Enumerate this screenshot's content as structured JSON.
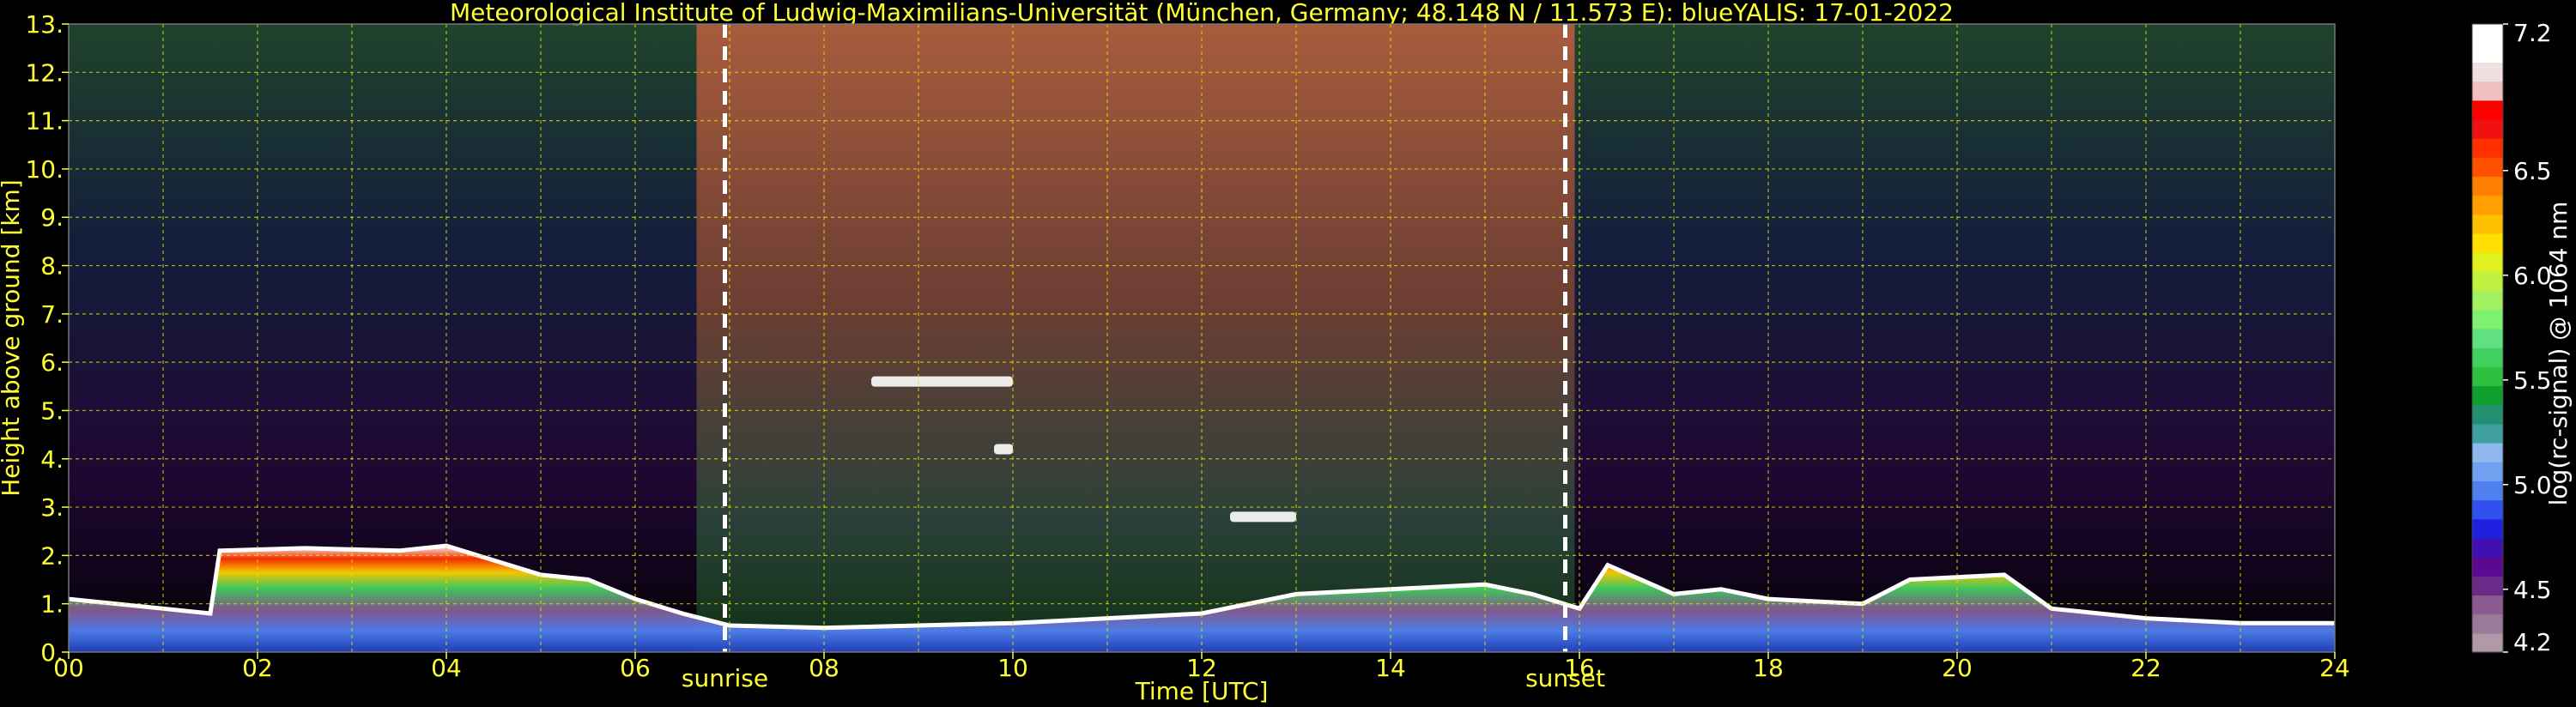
{
  "colors": {
    "background": "#000000",
    "text": "#ffff33",
    "grid": "#e6e600",
    "marker_line": "#ffffff",
    "colorbar_text": "#ffffff"
  },
  "chart_data": {
    "type": "heatmap",
    "title": "Meteorological Institute of Ludwig-Maximilians-Universität (München, Germany; 48.148 N / 11.573 E):    blueYALIS: 17-01-2022",
    "xlabel": "Time [UTC]",
    "ylabel": "Height above ground [km]",
    "xlim": [
      0,
      24
    ],
    "ylim": [
      0,
      13
    ],
    "x_ticks": [
      {
        "value": 0,
        "label": "00"
      },
      {
        "value": 2,
        "label": "02"
      },
      {
        "value": 4,
        "label": "04"
      },
      {
        "value": 6,
        "label": "06"
      },
      {
        "value": 8,
        "label": "08"
      },
      {
        "value": 10,
        "label": "10"
      },
      {
        "value": 12,
        "label": "12"
      },
      {
        "value": 14,
        "label": "14"
      },
      {
        "value": 16,
        "label": "16"
      },
      {
        "value": 18,
        "label": "18"
      },
      {
        "value": 20,
        "label": "20"
      },
      {
        "value": 22,
        "label": "22"
      },
      {
        "value": 24,
        "label": "24"
      }
    ],
    "y_ticks": [
      {
        "value": 0,
        "label": "0."
      },
      {
        "value": 1,
        "label": "1."
      },
      {
        "value": 2,
        "label": "2."
      },
      {
        "value": 3,
        "label": "3."
      },
      {
        "value": 4,
        "label": "4."
      },
      {
        "value": 5,
        "label": "5."
      },
      {
        "value": 6,
        "label": "6."
      },
      {
        "value": 7,
        "label": "7."
      },
      {
        "value": 8,
        "label": "8."
      },
      {
        "value": 9,
        "label": "9."
      },
      {
        "value": 10,
        "label": "10."
      },
      {
        "value": 11,
        "label": "11."
      },
      {
        "value": 12,
        "label": "12."
      },
      {
        "value": 13,
        "label": "13."
      }
    ],
    "grid": true,
    "markers": [
      {
        "label": "sunrise",
        "x": 6.95
      },
      {
        "label": "sunset",
        "x": 15.85
      }
    ],
    "boundary_layer_top_km": [
      [
        0.0,
        1.1
      ],
      [
        0.5,
        1.0
      ],
      [
        1.0,
        0.9
      ],
      [
        1.5,
        0.8
      ],
      [
        1.6,
        2.1
      ],
      [
        2.5,
        2.15
      ],
      [
        3.5,
        2.1
      ],
      [
        4.0,
        2.2
      ],
      [
        4.5,
        1.9
      ],
      [
        5.0,
        1.6
      ],
      [
        5.5,
        1.5
      ],
      [
        6.0,
        1.1
      ],
      [
        6.5,
        0.8
      ],
      [
        7.0,
        0.55
      ],
      [
        8.0,
        0.5
      ],
      [
        9.0,
        0.55
      ],
      [
        10.0,
        0.6
      ],
      [
        11.0,
        0.7
      ],
      [
        12.0,
        0.8
      ],
      [
        13.0,
        1.2
      ],
      [
        14.0,
        1.3
      ],
      [
        15.0,
        1.4
      ],
      [
        15.5,
        1.2
      ],
      [
        16.0,
        0.9
      ],
      [
        16.3,
        1.8
      ],
      [
        17.0,
        1.2
      ],
      [
        17.5,
        1.3
      ],
      [
        18.0,
        1.1
      ],
      [
        19.0,
        1.0
      ],
      [
        19.5,
        1.5
      ],
      [
        20.5,
        1.6
      ],
      [
        21.0,
        0.9
      ],
      [
        22.0,
        0.7
      ],
      [
        23.0,
        0.6
      ],
      [
        24.0,
        0.6
      ]
    ],
    "clouds": [
      {
        "time_start": 8.5,
        "time_end": 10.0,
        "height_km": 5.6
      },
      {
        "time_start": 9.8,
        "time_end": 10.0,
        "height_km": 4.2
      },
      {
        "time_start": 12.3,
        "time_end": 13.0,
        "height_km": 2.8
      }
    ],
    "colorbar": {
      "label": "log(rc-signal) @ 1064 nm",
      "min": 4.2,
      "max": 7.2,
      "ticks": [
        {
          "value": 4.2,
          "label": "4.2"
        },
        {
          "value": 4.5,
          "label": "4.5"
        },
        {
          "value": 5.0,
          "label": "5.0"
        },
        {
          "value": 5.5,
          "label": "5.5"
        },
        {
          "value": 6.0,
          "label": "6.0"
        },
        {
          "value": 6.5,
          "label": "6.5"
        },
        {
          "value": 7.2,
          "label": "7.2"
        }
      ],
      "colors": [
        "#b09aa8",
        "#9a7a98",
        "#8a5a90",
        "#6a2a88",
        "#5a0a90",
        "#4010b0",
        "#2020e0",
        "#3050f0",
        "#5080f0",
        "#70a0f0",
        "#90b8f0",
        "#40a0a0",
        "#209070",
        "#10a030",
        "#30c040",
        "#40d060",
        "#60e080",
        "#80f070",
        "#a0f060",
        "#c0f040",
        "#e0f020",
        "#ffe000",
        "#ffc000",
        "#ffa000",
        "#ff8000",
        "#ff5000",
        "#ff3000",
        "#f01010",
        "#ff0000",
        "#f0c0c0",
        "#f0e0e0",
        "#ffffff",
        "#ffffff"
      ]
    }
  }
}
